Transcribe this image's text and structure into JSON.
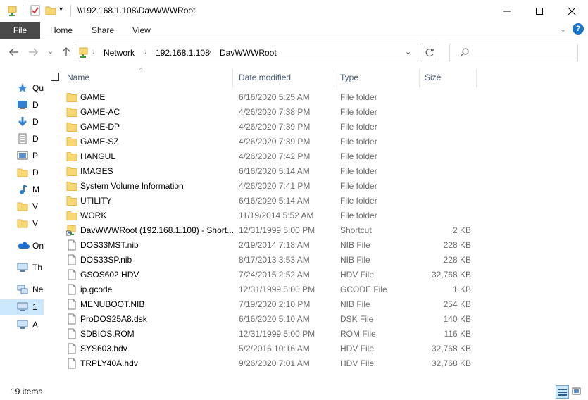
{
  "window": {
    "title": "\\\\192.168.1.108\\DavWWWRoot",
    "minimize_icon": "minimize-icon",
    "maximize_icon": "maximize-icon",
    "close_icon": "close-icon"
  },
  "ribbon": {
    "file": "File",
    "home": "Home",
    "share": "Share",
    "view": "View"
  },
  "address": {
    "crumbs": [
      "Network",
      "192.168.1.108",
      "DavWWWRoot"
    ]
  },
  "nav_pane": {
    "items": [
      {
        "label": "Qu",
        "icon": "star-icon"
      },
      {
        "label": "D",
        "icon": "desktop-icon"
      },
      {
        "label": "D",
        "icon": "download-icon"
      },
      {
        "label": "D",
        "icon": "document-icon"
      },
      {
        "label": "P",
        "icon": "pictures-icon"
      },
      {
        "label": "D",
        "icon": "folder-icon"
      },
      {
        "label": "M",
        "icon": "music-icon"
      },
      {
        "label": "V",
        "icon": "folder-icon"
      },
      {
        "label": "V",
        "icon": "folder-icon"
      },
      {
        "label": "On",
        "icon": "cloud-icon"
      },
      {
        "label": "Th",
        "icon": "computer-icon"
      },
      {
        "label": "Ne",
        "icon": "network-icon"
      },
      {
        "label": "1",
        "icon": "computer-icon"
      },
      {
        "label": "A",
        "icon": "computer-icon"
      }
    ]
  },
  "columns": {
    "name": "Name",
    "date": "Date modified",
    "type": "Type",
    "size": "Size"
  },
  "files": [
    {
      "name": "GAME",
      "date": "6/16/2020 5:25 AM",
      "type": "File folder",
      "size": "",
      "icon": "folder"
    },
    {
      "name": "GAME-AC",
      "date": "4/26/2020 7:38 PM",
      "type": "File folder",
      "size": "",
      "icon": "folder"
    },
    {
      "name": "GAME-DP",
      "date": "4/26/2020 7:39 PM",
      "type": "File folder",
      "size": "",
      "icon": "folder"
    },
    {
      "name": "GAME-SZ",
      "date": "4/26/2020 7:39 PM",
      "type": "File folder",
      "size": "",
      "icon": "folder"
    },
    {
      "name": "HANGUL",
      "date": "4/26/2020 7:42 PM",
      "type": "File folder",
      "size": "",
      "icon": "folder"
    },
    {
      "name": "IMAGES",
      "date": "6/16/2020 5:14 AM",
      "type": "File folder",
      "size": "",
      "icon": "folder"
    },
    {
      "name": "System Volume Information",
      "date": "4/26/2020 7:41 PM",
      "type": "File folder",
      "size": "",
      "icon": "folder"
    },
    {
      "name": "UTILITY",
      "date": "6/16/2020 5:14 AM",
      "type": "File folder",
      "size": "",
      "icon": "folder"
    },
    {
      "name": "WORK",
      "date": "11/19/2014 5:52 AM",
      "type": "File folder",
      "size": "",
      "icon": "folder"
    },
    {
      "name": "DavWWWRoot (192.168.1.108) - Short...",
      "date": "12/31/1999 5:00 PM",
      "type": "Shortcut",
      "size": "2 KB",
      "icon": "shortcut"
    },
    {
      "name": "DOS33MST.nib",
      "date": "2/19/2014 7:18 AM",
      "type": "NIB File",
      "size": "228 KB",
      "icon": "file"
    },
    {
      "name": "DOS33SP.nib",
      "date": "8/17/2013 3:53 AM",
      "type": "NIB File",
      "size": "228 KB",
      "icon": "file"
    },
    {
      "name": "GSOS602.HDV",
      "date": "7/24/2015 2:52 AM",
      "type": "HDV File",
      "size": "32,768 KB",
      "icon": "file"
    },
    {
      "name": "ip.gcode",
      "date": "12/31/1999 5:00 PM",
      "type": "GCODE File",
      "size": "1 KB",
      "icon": "file"
    },
    {
      "name": "MENUBOOT.NIB",
      "date": "7/19/2020 2:10 PM",
      "type": "NIB File",
      "size": "254 KB",
      "icon": "file"
    },
    {
      "name": "ProDOS25A8.dsk",
      "date": "6/16/2020 5:10 AM",
      "type": "DSK File",
      "size": "140 KB",
      "icon": "file"
    },
    {
      "name": "SDBIOS.ROM",
      "date": "12/31/1999 5:00 PM",
      "type": "ROM File",
      "size": "116 KB",
      "icon": "file"
    },
    {
      "name": "SYS603.hdv",
      "date": "5/2/2016 10:16 AM",
      "type": "HDV File",
      "size": "32,768 KB",
      "icon": "file"
    },
    {
      "name": "TRPLY40A.hdv",
      "date": "9/26/2020 7:01 AM",
      "type": "HDV File",
      "size": "32,768 KB",
      "icon": "file"
    }
  ],
  "status": {
    "item_count": "19 items"
  },
  "colors": {
    "folder": "#f8d775",
    "folder_dark": "#e8b84a",
    "file_tab_bg": "#4a4a4a",
    "selected_nav": "#cce8ff",
    "header_text": "#4c607a"
  }
}
